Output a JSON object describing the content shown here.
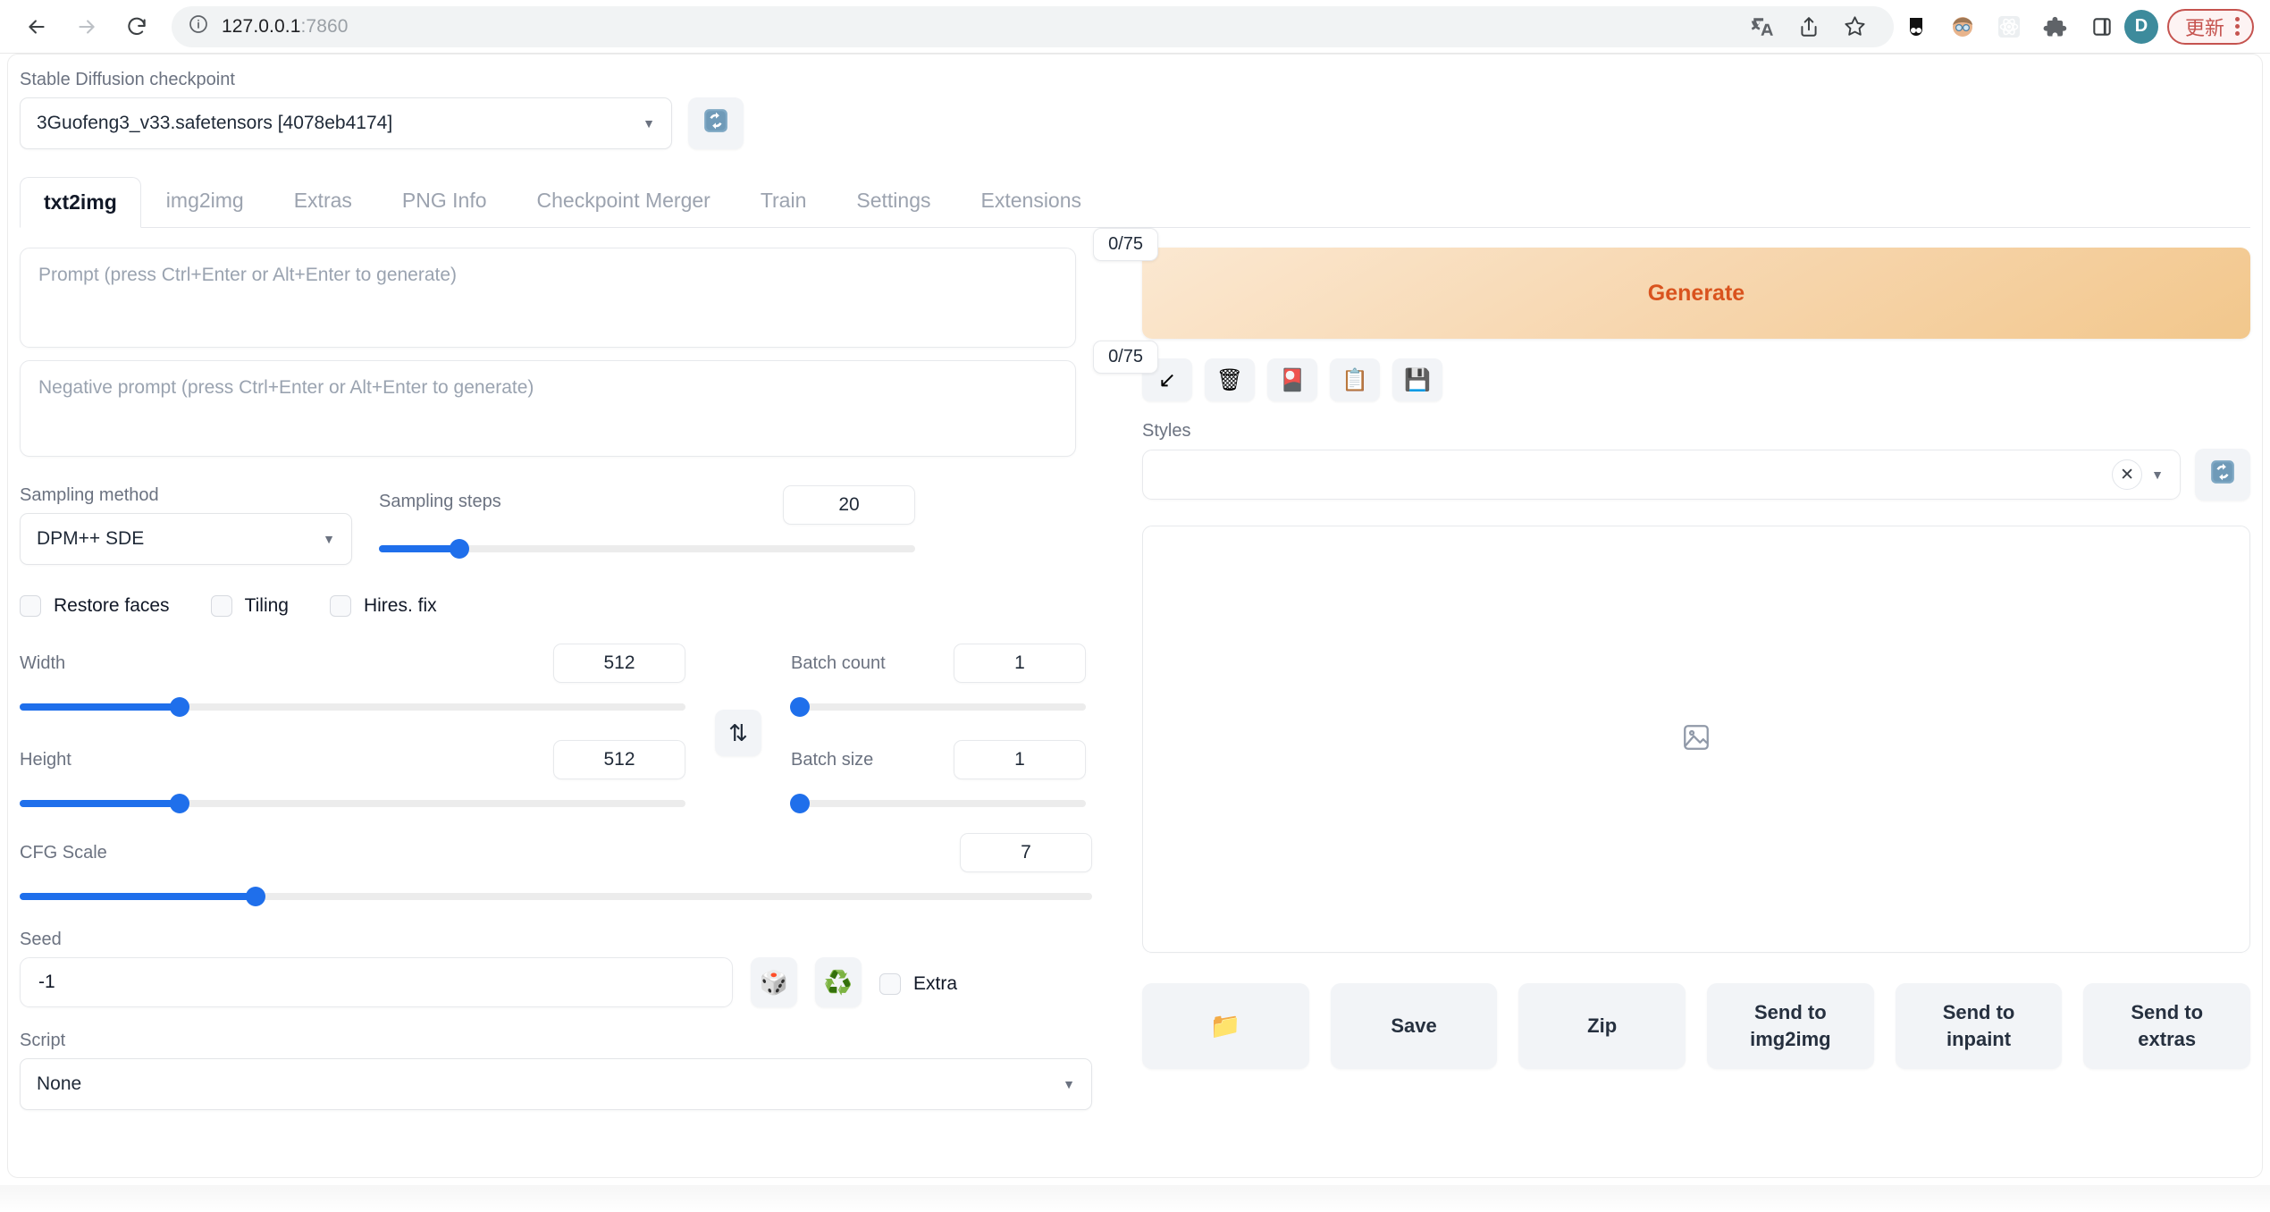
{
  "browser": {
    "back_icon": "back-arrow-icon",
    "forward_icon": "forward-arrow-icon",
    "reload_icon": "reload-icon",
    "site_info_icon": "info-circle-icon",
    "url_host": "127.0.0.1",
    "url_port": ":7860",
    "toolbar_icons": [
      {
        "name": "translate-icon",
        "glyph": "🌐"
      },
      {
        "name": "share-icon",
        "glyph": "⇧"
      },
      {
        "name": "bookmark-star-icon",
        "glyph": "☆"
      },
      {
        "name": "extension-dark-icon",
        "glyph": "◑"
      },
      {
        "name": "extension-avatar-icon",
        "glyph": "😎"
      },
      {
        "name": "react-devtools-icon",
        "glyph": "⚛"
      },
      {
        "name": "extensions-puzzle-icon",
        "glyph": "🧩"
      },
      {
        "name": "side-panel-icon",
        "glyph": "▯"
      }
    ],
    "avatar_initial": "D",
    "update_label": "更新",
    "menu_icon": "kebab-menu-icon"
  },
  "checkpoint": {
    "label": "Stable Diffusion checkpoint",
    "value": "3Guofeng3_v33.safetensors [4078eb4174]",
    "refresh_icon": "refresh-icon"
  },
  "tabs": [
    {
      "label": "txt2img",
      "active": true
    },
    {
      "label": "img2img",
      "active": false
    },
    {
      "label": "Extras",
      "active": false
    },
    {
      "label": "PNG Info",
      "active": false
    },
    {
      "label": "Checkpoint Merger",
      "active": false
    },
    {
      "label": "Train",
      "active": false
    },
    {
      "label": "Settings",
      "active": false
    },
    {
      "label": "Extensions",
      "active": false
    }
  ],
  "prompt": {
    "placeholder": "Prompt (press Ctrl+Enter or Alt+Enter to generate)",
    "value": "",
    "token_count": "0/75"
  },
  "negative_prompt": {
    "placeholder": "Negative prompt (press Ctrl+Enter or Alt+Enter to generate)",
    "value": "",
    "token_count": "0/75"
  },
  "settings": {
    "sampling_method": {
      "label": "Sampling method",
      "value": "DPM++ SDE"
    },
    "sampling_steps": {
      "label": "Sampling steps",
      "value": "20",
      "min": 1,
      "max": 150,
      "fill_pct": 15
    },
    "checkboxes": [
      {
        "label": "Restore faces",
        "checked": false
      },
      {
        "label": "Tiling",
        "checked": false
      },
      {
        "label": "Hires. fix",
        "checked": false
      }
    ],
    "width": {
      "label": "Width",
      "value": "512",
      "min": 64,
      "max": 2048,
      "fill_pct": 24
    },
    "height": {
      "label": "Height",
      "value": "512",
      "min": 64,
      "max": 2048,
      "fill_pct": 24
    },
    "batch_count": {
      "label": "Batch count",
      "value": "1",
      "min": 1,
      "max": 100,
      "fill_pct": 2
    },
    "batch_size": {
      "label": "Batch size",
      "value": "1",
      "min": 1,
      "max": 8,
      "fill_pct": 2
    },
    "cfg_scale": {
      "label": "CFG Scale",
      "value": "7",
      "min": 1,
      "max": 30,
      "fill_pct": 22
    },
    "swap_icon": "swap-dimensions-icon",
    "seed": {
      "label": "Seed",
      "value": "-1",
      "random_icon": "dice-icon",
      "reuse_icon": "recycle-icon",
      "extra_label": "Extra",
      "extra_checked": false
    },
    "script": {
      "label": "Script",
      "value": "None"
    }
  },
  "right_panel": {
    "generate_label": "Generate",
    "tool_buttons": [
      {
        "name": "read-generation-params-button",
        "glyph": "↙"
      },
      {
        "name": "clear-prompt-button",
        "glyph": "🗑"
      },
      {
        "name": "show-extra-networks-button",
        "glyph": "🎴"
      },
      {
        "name": "apply-style-button",
        "glyph": "📋"
      },
      {
        "name": "save-style-button",
        "glyph": "💾"
      }
    ],
    "styles": {
      "label": "Styles",
      "value": "",
      "clear_glyph": "✕",
      "refresh_icon": "refresh-icon"
    },
    "gallery_placeholder_icon": "image-placeholder-icon",
    "actions": [
      {
        "name": "open-folder-button",
        "label": "📁",
        "icon_only": true
      },
      {
        "name": "save-button",
        "label": "Save",
        "icon_only": false
      },
      {
        "name": "zip-button",
        "label": "Zip",
        "icon_only": false
      },
      {
        "name": "send-to-img2img-button",
        "label": "Send to\nimg2img",
        "icon_only": false
      },
      {
        "name": "send-to-inpaint-button",
        "label": "Send to\ninpaint",
        "icon_only": false
      },
      {
        "name": "send-to-extras-button",
        "label": "Send to\nextras",
        "icon_only": false
      }
    ]
  },
  "colors": {
    "accent_blue": "#1f6feb",
    "generate_text": "#d9531e",
    "generate_gradient_start": "#fbe8d1",
    "generate_gradient_end": "#f2c78c",
    "update_red": "#c5534f",
    "avatar_teal": "#3d8b9c"
  }
}
